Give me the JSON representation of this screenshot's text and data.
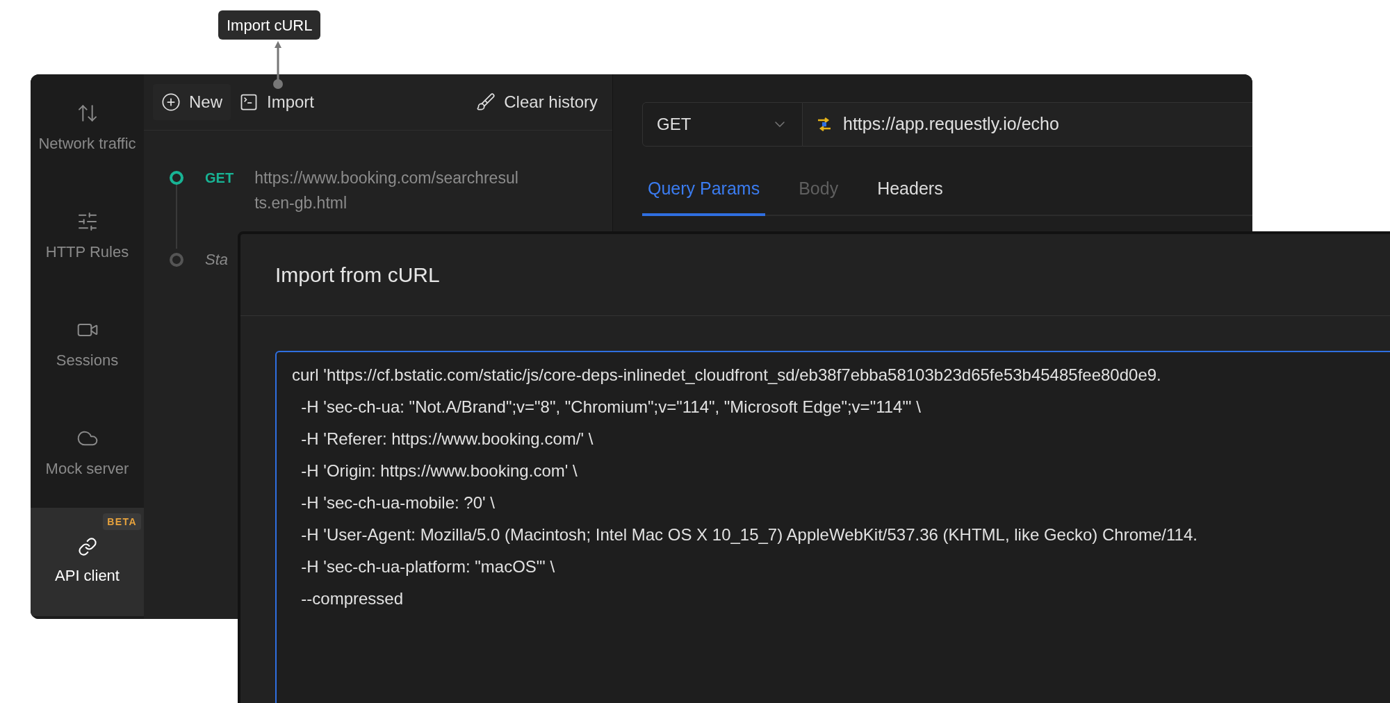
{
  "tooltip": {
    "text": "Import cURL"
  },
  "sidebar": {
    "items": [
      {
        "label": "Network traffic",
        "kind": "arrows",
        "selected": false
      },
      {
        "label": "HTTP Rules",
        "kind": "sliders",
        "selected": false
      },
      {
        "label": "Sessions",
        "kind": "video",
        "selected": false
      },
      {
        "label": "Mock server",
        "kind": "cloud",
        "selected": false
      },
      {
        "label": "API client",
        "kind": "link",
        "selected": true,
        "badge": "BETA"
      }
    ]
  },
  "history_toolbar": {
    "new": "New",
    "import": "Import",
    "clear": "Clear history"
  },
  "history": [
    {
      "method": "GET",
      "url": "https://www.booking.com/searchresul ts.en-gb.html",
      "selected": true
    },
    {
      "text": "Sta",
      "selected": false
    }
  ],
  "request": {
    "method": "GET",
    "url": "https://app.requestly.io/echo",
    "tabs": [
      {
        "label": "Query Params",
        "selected": true,
        "disabled": false
      },
      {
        "label": "Body",
        "selected": false,
        "disabled": true
      },
      {
        "label": "Headers",
        "selected": false,
        "disabled": false
      }
    ]
  },
  "dialog": {
    "title": "Import from cURL",
    "lines": [
      "curl 'https://cf.bstatic.com/static/js/core-deps-inlinedet_cloudfront_sd/eb38f7ebba58103b23d65fe53b45485fee80d0e9.",
      "  -H 'sec-ch-ua: \"Not.A/Brand\";v=\"8\", \"Chromium\";v=\"114\", \"Microsoft Edge\";v=\"114\"' \\",
      "  -H 'Referer: https://www.booking.com/' \\",
      "  -H 'Origin: https://www.booking.com' \\",
      "  -H 'sec-ch-ua-mobile: ?0' \\",
      "  -H 'User-Agent: Mozilla/5.0 (Macintosh; Intel Mac OS X 10_15_7) AppleWebKit/537.36 (KHTML, like Gecko) Chrome/114.",
      "  -H 'sec-ch-ua-platform: \"macOS\"' \\",
      "  --compressed"
    ]
  }
}
